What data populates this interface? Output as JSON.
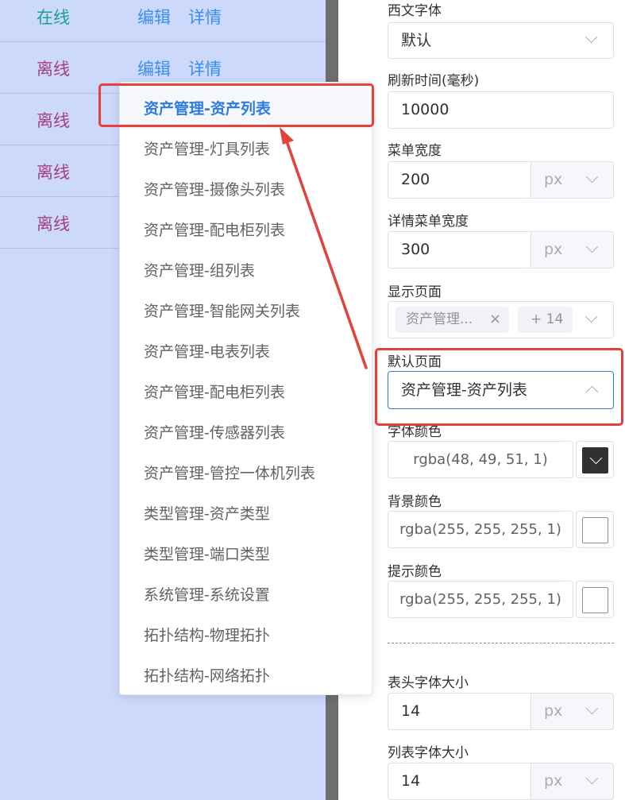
{
  "table": {
    "rows": [
      {
        "status": "在线",
        "kind": "online",
        "edit": "编辑",
        "detail": "详情"
      },
      {
        "status": "离线",
        "kind": "offline",
        "edit": "编辑",
        "detail": "详情"
      },
      {
        "status": "离线",
        "kind": "offline"
      },
      {
        "status": "离线",
        "kind": "offline"
      },
      {
        "status": "离线",
        "kind": "offline"
      }
    ]
  },
  "dropdown": {
    "items": [
      "资产管理-资产列表",
      "资产管理-灯具列表",
      "资产管理-摄像头列表",
      "资产管理-配电柜列表",
      "资产管理-组列表",
      "资产管理-智能网关列表",
      "资产管理-电表列表",
      "资产管理-配电柜列表",
      "资产管理-传感器列表",
      "资产管理-管控一体机列表",
      "类型管理-资产类型",
      "类型管理-端口类型",
      "系统管理-系统设置",
      "拓扑结构-物理拓扑",
      "拓扑结构-网络拓扑"
    ],
    "selected_index": 0
  },
  "form": {
    "western_font": {
      "label": "西文字体",
      "value": "默认"
    },
    "refresh_time": {
      "label": "刷新时间(毫秒)",
      "value": "10000"
    },
    "menu_width": {
      "label": "菜单宽度",
      "value": "200",
      "unit": "px"
    },
    "detail_menu_width": {
      "label": "详情菜单宽度",
      "value": "300",
      "unit": "px"
    },
    "display_pages": {
      "label": "显示页面",
      "tag": "资产管理...",
      "more": "+ 14"
    },
    "default_page": {
      "label": "默认页面",
      "value": "资产管理-资产列表"
    },
    "font_color": {
      "label": "字体颜色",
      "value": "rgba(48, 49, 51, 1)",
      "swatch": "#303133"
    },
    "background_color": {
      "label": "背景颜色",
      "value": "rgba(255, 255, 255, 1)",
      "swatch": "#ffffff"
    },
    "hint_color": {
      "label": "提示颜色",
      "value": "rgba(255, 255, 255, 1)",
      "swatch": "#ffffff"
    },
    "header_font_size": {
      "label": "表头字体大小",
      "value": "14",
      "unit": "px"
    },
    "list_font_size": {
      "label": "列表字体大小",
      "value": "14",
      "unit": "px"
    }
  },
  "colors": {
    "selected_blue": "#2f7bdd",
    "annotation_red": "#e5403a",
    "online_green": "#19a09a",
    "offline_magenta": "#a33f7e",
    "link_blue": "#3b8ff0"
  }
}
